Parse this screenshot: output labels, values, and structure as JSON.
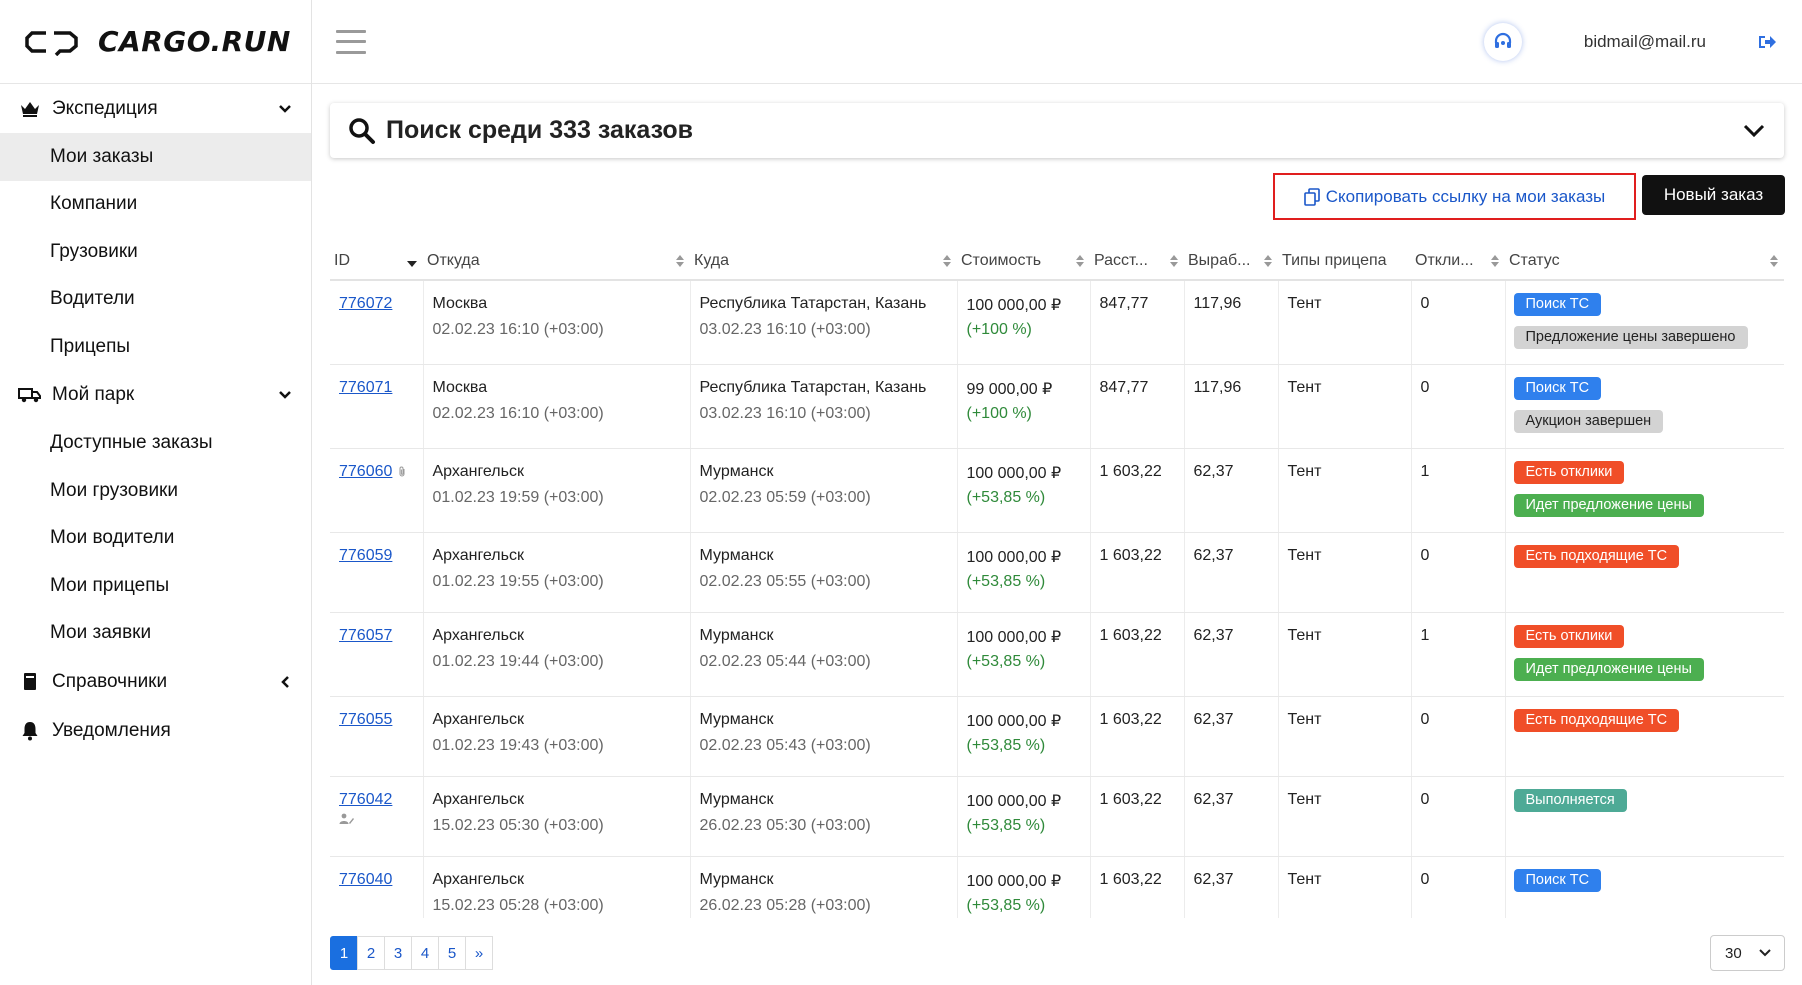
{
  "app": {
    "logo_text": "CARGO.RUN"
  },
  "header": {
    "email": "bidmail@mail.ru"
  },
  "sidebar": {
    "groups": [
      {
        "label": "Экспедиция",
        "items": [
          "Мои заказы",
          "Компании",
          "Грузовики",
          "Водители",
          "Прицепы"
        ]
      },
      {
        "label": "Мой парк",
        "items": [
          "Доступные заказы",
          "Мои грузовики",
          "Мои водители",
          "Мои прицепы",
          "Мои заявки"
        ]
      },
      {
        "label": "Справочники",
        "items": []
      },
      {
        "label": "Уведомления",
        "items": []
      }
    ]
  },
  "search": {
    "title": "Поиск среди 333 заказов"
  },
  "actions": {
    "copy_link": "Скопировать ссылку на мои заказы",
    "new_order": "Новый заказ"
  },
  "table": {
    "columns": [
      "ID",
      "Откуда",
      "Куда",
      "Стоимость",
      "Расст...",
      "Выраб...",
      "Типы прицепа",
      "Откли...",
      "Статус"
    ],
    "rows": [
      {
        "id": "776072",
        "from": "Москва",
        "from_date": "02.02.23 16:10 (+03:00)",
        "to": "Республика Татарстан, Казань",
        "to_date": "03.02.23 16:10 (+03:00)",
        "price": "100 000,00 ₽",
        "pct": "(+100 %)",
        "dist": "847,77",
        "yield": "117,96",
        "trailer": "Тент",
        "responses": "0",
        "statuses": [
          {
            "text": "Поиск ТС",
            "color": "blue"
          },
          {
            "text": "Предложение цены завершено",
            "color": "gray"
          }
        ]
      },
      {
        "id": "776071",
        "from": "Москва",
        "from_date": "02.02.23 16:10 (+03:00)",
        "to": "Республика Татарстан, Казань",
        "to_date": "03.02.23 16:10 (+03:00)",
        "price": "99 000,00 ₽",
        "pct": "(+100 %)",
        "dist": "847,77",
        "yield": "117,96",
        "trailer": "Тент",
        "responses": "0",
        "statuses": [
          {
            "text": "Поиск ТС",
            "color": "blue"
          },
          {
            "text": "Аукцион завершен",
            "color": "gray"
          }
        ]
      },
      {
        "id": "776060",
        "from": "Архангельск",
        "from_date": "01.02.23 19:59 (+03:00)",
        "to": "Мурманск",
        "to_date": "02.02.23 05:59 (+03:00)",
        "price": "100 000,00 ₽",
        "pct": "(+53,85 %)",
        "dist": "1 603,22",
        "yield": "62,37",
        "trailer": "Тент",
        "responses": "1",
        "statuses": [
          {
            "text": "Есть отклики",
            "color": "red"
          },
          {
            "text": "Идет предложение цены",
            "color": "green"
          }
        ]
      },
      {
        "id": "776059",
        "from": "Архангельск",
        "from_date": "01.02.23 19:55 (+03:00)",
        "to": "Мурманск",
        "to_date": "02.02.23 05:55 (+03:00)",
        "price": "100 000,00 ₽",
        "pct": "(+53,85 %)",
        "dist": "1 603,22",
        "yield": "62,37",
        "trailer": "Тент",
        "responses": "0",
        "statuses": [
          {
            "text": "Есть подходящие ТС",
            "color": "red"
          }
        ]
      },
      {
        "id": "776057",
        "from": "Архангельск",
        "from_date": "01.02.23 19:44 (+03:00)",
        "to": "Мурманск",
        "to_date": "02.02.23 05:44 (+03:00)",
        "price": "100 000,00 ₽",
        "pct": "(+53,85 %)",
        "dist": "1 603,22",
        "yield": "62,37",
        "trailer": "Тент",
        "responses": "1",
        "statuses": [
          {
            "text": "Есть отклики",
            "color": "red"
          },
          {
            "text": "Идет предложение цены",
            "color": "green"
          }
        ]
      },
      {
        "id": "776055",
        "from": "Архангельск",
        "from_date": "01.02.23 19:43 (+03:00)",
        "to": "Мурманск",
        "to_date": "02.02.23 05:43 (+03:00)",
        "price": "100 000,00 ₽",
        "pct": "(+53,85 %)",
        "dist": "1 603,22",
        "yield": "62,37",
        "trailer": "Тент",
        "responses": "0",
        "statuses": [
          {
            "text": "Есть подходящие ТС",
            "color": "red"
          }
        ]
      },
      {
        "id": "776042",
        "from": "Архангельск",
        "from_date": "15.02.23 05:30 (+03:00)",
        "to": "Мурманск",
        "to_date": "26.02.23 05:30 (+03:00)",
        "price": "100 000,00 ₽",
        "pct": "(+53,85 %)",
        "dist": "1 603,22",
        "yield": "62,37",
        "trailer": "Тент",
        "responses": "0",
        "statuses": [
          {
            "text": "Выполняется",
            "color": "teal"
          }
        ]
      },
      {
        "id": "776040",
        "from": "Архангельск",
        "from_date": "15.02.23 05:28 (+03:00)",
        "to": "Мурманск",
        "to_date": "26.02.23 05:28 (+03:00)",
        "price": "100 000,00 ₽",
        "pct": "(+53,85 %)",
        "dist": "1 603,22",
        "yield": "62,37",
        "trailer": "Тент",
        "responses": "0",
        "statuses": [
          {
            "text": "Поиск ТС",
            "color": "blue"
          }
        ]
      }
    ]
  },
  "pagination": {
    "pages": [
      "1",
      "2",
      "3",
      "4",
      "5",
      "»"
    ],
    "per_page": "30"
  }
}
